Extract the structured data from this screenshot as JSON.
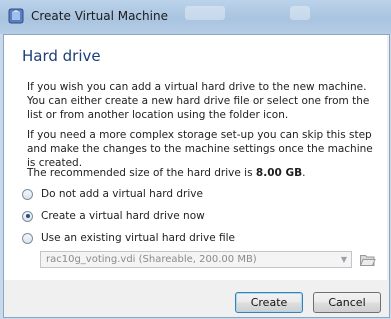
{
  "window": {
    "title": "Create Virtual Machine",
    "icon": "virtualbox-icon"
  },
  "page": {
    "heading": "Hard drive",
    "paragraph1": "If you wish you can add a virtual hard drive to the new machine. You can either create a new hard drive file or select one from the list or from another location using the folder icon.",
    "paragraph2": "If you need a more complex storage set-up you can skip this step and make the changes to the machine settings once the machine is created.",
    "recommended_prefix": "The recommended size of the hard drive is ",
    "recommended_size": "8.00 GB",
    "recommended_suffix": "."
  },
  "options": [
    {
      "label": "Do not add a virtual hard drive",
      "selected": false
    },
    {
      "label": "Create a virtual hard drive now",
      "selected": true
    },
    {
      "label": "Use an existing virtual hard drive file",
      "selected": false
    }
  ],
  "existing_disk": {
    "value": "rac10g_voting.vdi (Shareable, 200.00 MB)",
    "enabled": false,
    "folder_icon": "folder-open-icon",
    "arrow_icon": "chevron-down-icon"
  },
  "buttons": {
    "create": "Create",
    "cancel": "Cancel"
  },
  "colors": {
    "heading": "#1c3f78",
    "titlebar": "#a9c4e0",
    "frame": "#f0f0f0"
  }
}
